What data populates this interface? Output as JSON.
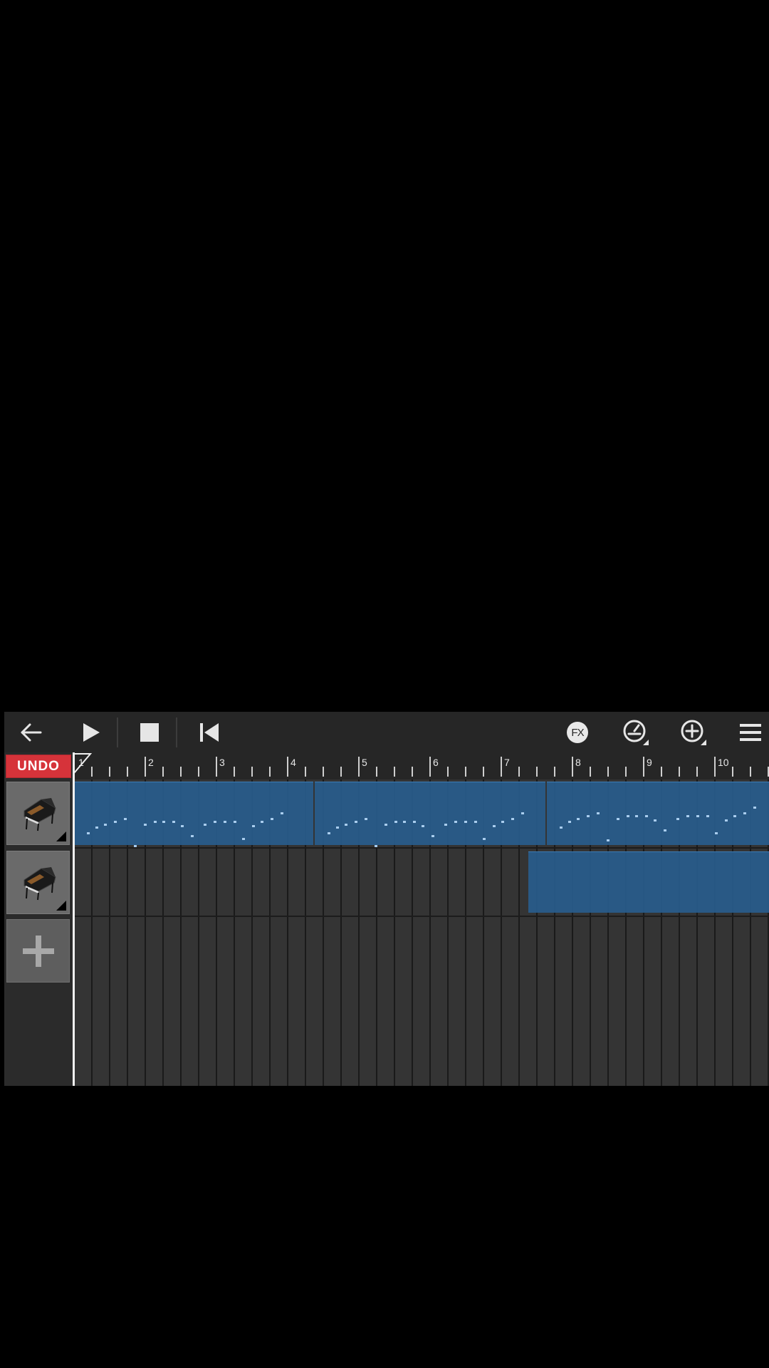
{
  "toolbar": {
    "back_icon": "arrow-left-icon",
    "play_icon": "play-icon",
    "stop_icon": "stop-icon",
    "rewind_icon": "skip-to-start-icon",
    "fx_label": "FX",
    "metronome_icon": "metronome-icon",
    "add_icon": "plus-circle-icon",
    "menu_icon": "hamburger-menu-icon"
  },
  "undo": {
    "label": "UNDO"
  },
  "ruler": {
    "bars": [
      "1",
      "2",
      "3",
      "4",
      "5",
      "6",
      "7",
      "8",
      "9",
      "10"
    ]
  },
  "tracks": [
    {
      "instrument": "grand-piano-icon"
    },
    {
      "instrument": "grand-piano-icon"
    }
  ],
  "add_track": {
    "icon": "plus-icon"
  },
  "colors": {
    "background": "#000000",
    "toolbar": "#262626",
    "undo": "#d6333a",
    "clip": "#285c8c"
  }
}
